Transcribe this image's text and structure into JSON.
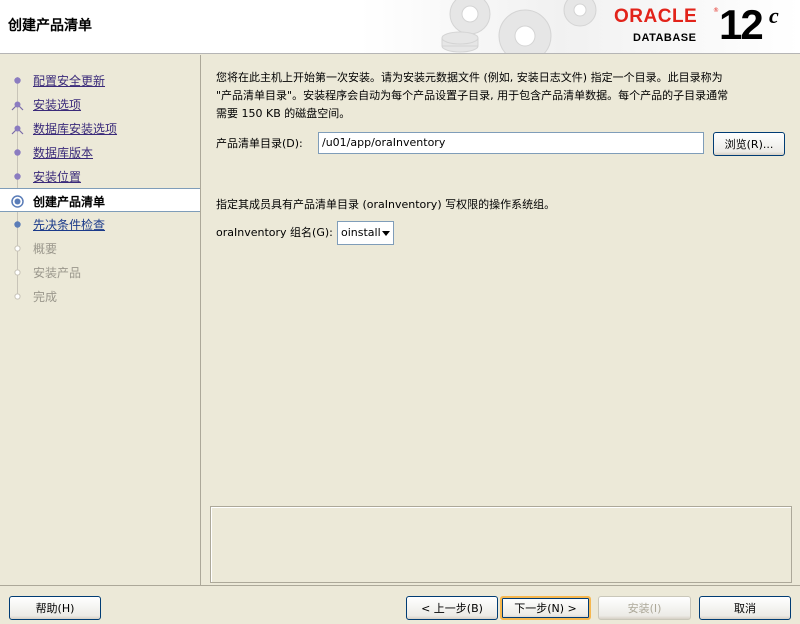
{
  "header": {
    "title": "创建产品清单",
    "brand": "ORACLE",
    "brand_reg": "®",
    "product": "DATABASE",
    "version": "12",
    "version_suffix": "c"
  },
  "sidebar": {
    "steps": [
      {
        "label": "配置安全更新",
        "state": "done"
      },
      {
        "label": "安装选项",
        "state": "done"
      },
      {
        "label": "数据库安装选项",
        "state": "done"
      },
      {
        "label": "数据库版本",
        "state": "done"
      },
      {
        "label": "安装位置",
        "state": "done"
      },
      {
        "label": "创建产品清单",
        "state": "current"
      },
      {
        "label": "先决条件检查",
        "state": "next"
      },
      {
        "label": "概要",
        "state": "pending"
      },
      {
        "label": "安装产品",
        "state": "pending"
      },
      {
        "label": "完成",
        "state": "pending"
      }
    ]
  },
  "main": {
    "intro_line1": "您将在此主机上开始第一次安装。请为安装元数据文件 (例如, 安装日志文件) 指定一个目录。此目录称为",
    "intro_line2": "\"产品清单目录\"。安装程序会自动为每个产品设置子目录, 用于包含产品清单数据。每个产品的子目录通常",
    "intro_line3": "需要 150 KB 的磁盘空间。",
    "inventory_label": "产品清单目录(D):",
    "inventory_value": "/u01/app/oraInventory",
    "browse_label": "浏览(R)...",
    "group_description": "指定其成员具有产品清单目录 (oraInventory) 写权限的操作系统组。",
    "group_label": "oraInventory 组名(G):",
    "group_selected": "oinstall"
  },
  "footer": {
    "help": "帮助(H)",
    "back": "< 上一步(B)",
    "next": "下一步(N) >",
    "install": "安装(I)",
    "cancel": "取消"
  }
}
